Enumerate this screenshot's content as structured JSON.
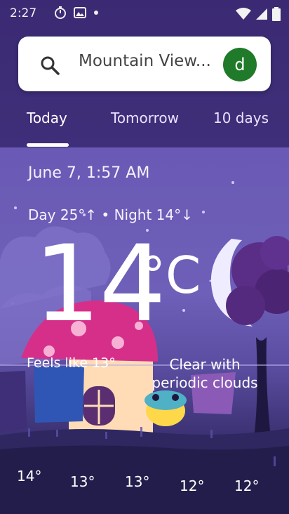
{
  "status_bar": {
    "time": "2:27",
    "icons": [
      "timer-icon",
      "photos-icon",
      "dot-icon",
      "wifi-icon",
      "signal-icon",
      "battery-icon"
    ]
  },
  "search": {
    "location": "Mountain View...",
    "avatar_letter": "d"
  },
  "tabs": [
    {
      "label": "Today",
      "active": true
    },
    {
      "label": "Tomorrow",
      "active": false
    },
    {
      "label": "10 days",
      "active": false
    }
  ],
  "weather": {
    "date_time": "June 7, 1:57 AM",
    "day_night": "Day 25°↑ • Night 14°↓",
    "temperature": "14",
    "unit": "°C",
    "feels_like": "Feels like 13°",
    "condition": "Clear with periodic clouds"
  },
  "hourly": [
    "14°",
    "13°",
    "13°",
    "12°",
    "12°"
  ],
  "colors": {
    "accent_green": "#1f7a2a",
    "sky_purple": "#6a5ab5",
    "ground_dark": "#2a2350"
  }
}
